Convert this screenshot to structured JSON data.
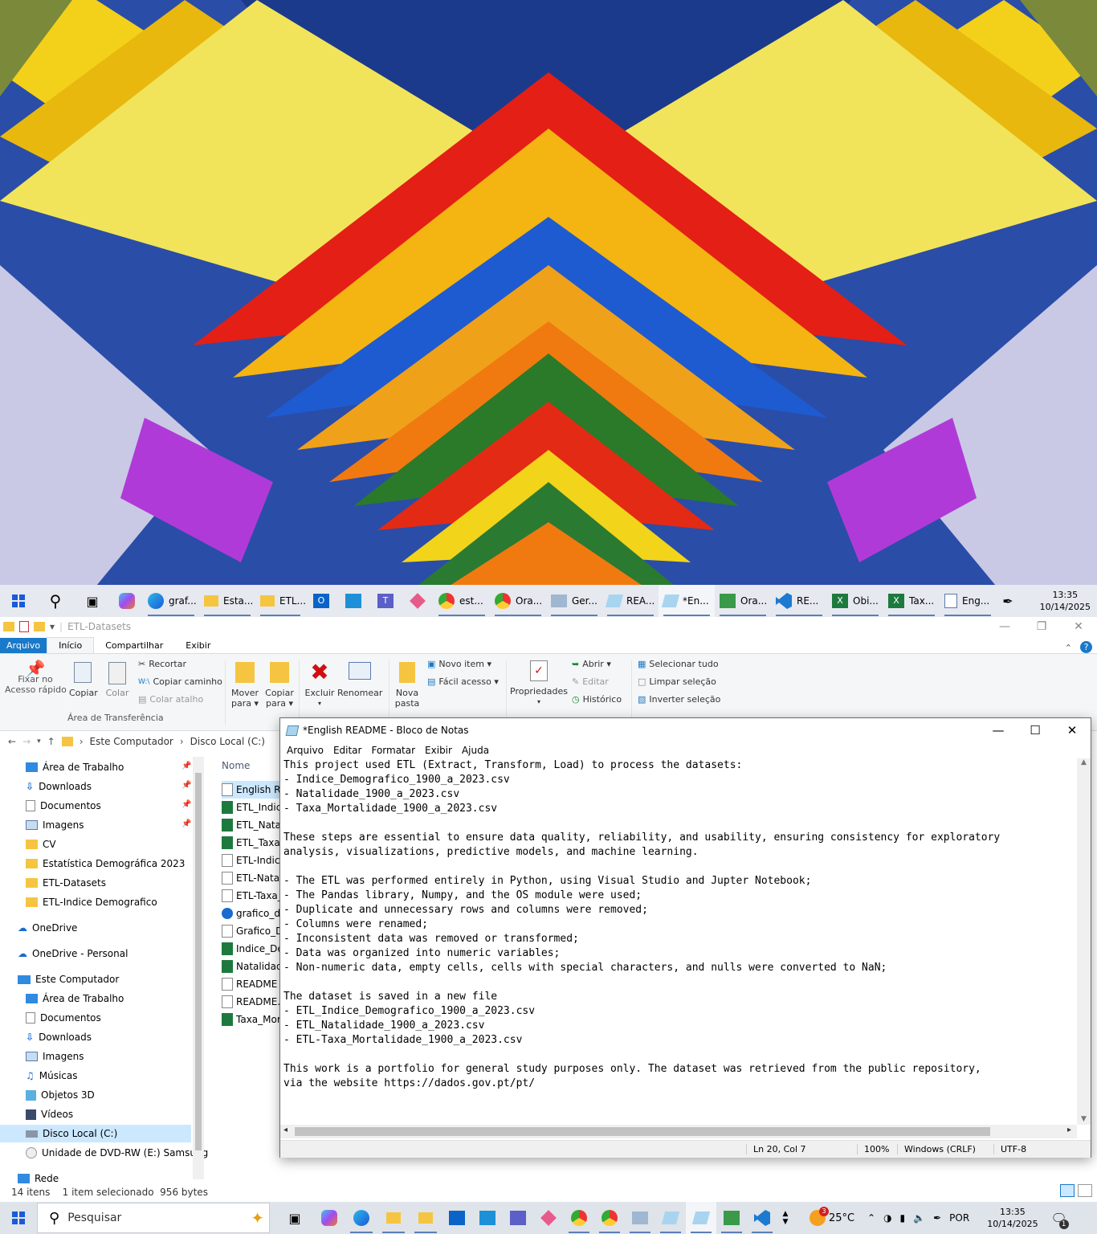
{
  "taskbar_top": {
    "items": [
      {
        "label": "graf..."
      },
      {
        "label": "Esta..."
      },
      {
        "label": "ETL..."
      },
      {
        "label": "est..."
      },
      {
        "label": "Ora..."
      },
      {
        "label": "Ger..."
      },
      {
        "label": "REA..."
      },
      {
        "label": "*En..."
      },
      {
        "label": "Ora..."
      },
      {
        "label": "RE..."
      },
      {
        "label": "Obi..."
      },
      {
        "label": "Tax..."
      },
      {
        "label": "Eng..."
      }
    ],
    "time": "13:35",
    "date": "10/14/2025"
  },
  "explorer": {
    "title": "ETL-Datasets",
    "tabs": {
      "file": "Arquivo",
      "home": "Início",
      "share": "Compartilhar",
      "view": "Exibir"
    },
    "ribbon": {
      "pin": "Fixar no\nAcesso rápido",
      "copy": "Copiar",
      "paste": "Colar",
      "cut": "Recortar",
      "copy_path": "Copiar caminho",
      "paste_shortcut": "Colar atalho",
      "clipboard_group": "Área de Transferência",
      "move_to": "Mover\npara ▾",
      "copy_to": "Copiar\npara ▾",
      "delete": "Excluir",
      "rename": "Renomear",
      "new_folder": "Nova\npasta",
      "new_item": "Novo item ▾",
      "easy_access": "Fácil acesso ▾",
      "properties": "Propriedades",
      "open": "Abrir ▾",
      "edit": "Editar",
      "history": "Histórico",
      "select_all": "Selecionar tudo",
      "select_none": "Limpar seleção",
      "invert": "Inverter seleção"
    },
    "address": {
      "root": "Este Computador",
      "drive": "Disco Local (C:)"
    },
    "nav": {
      "quick": [
        "Área de Trabalho",
        "Downloads",
        "Documentos",
        "Imagens",
        "CV",
        "Estatística Demográfica 2023",
        "ETL-Datasets",
        "ETL-Indice Demografico"
      ],
      "onedrive": "OneDrive",
      "onedrive_personal": "OneDrive - Personal",
      "this_pc": "Este Computador",
      "pc_items": [
        "Área de Trabalho",
        "Documentos",
        "Downloads",
        "Imagens",
        "Músicas",
        "Objetos 3D",
        "Vídeos",
        "Disco Local (C:)",
        "Unidade de DVD-RW (E:) Samsung"
      ],
      "network": "Rede"
    },
    "column_name": "Nome",
    "files": [
      "English REA",
      "ETL_Indice",
      "ETL_Natali",
      "ETL_Taxa_",
      "ETL-Indice",
      "ETL-Natali",
      "ETL-Taxa_",
      "grafico_di",
      "Grafico_D",
      "Indice_De",
      "Natalidad",
      "README",
      "README.",
      "Taxa_Mor"
    ],
    "status": "14 itens    1 item selecionado  956 bytes"
  },
  "notepad": {
    "title": "*English README - Bloco de Notas",
    "menu": [
      "Arquivo",
      "Editar",
      "Formatar",
      "Exibir",
      "Ajuda"
    ],
    "text": "This project used ETL (Extract, Transform, Load) to process the datasets:\n- Indice_Demografico_1900_a_2023.csv\n- Natalidade_1900_a_2023.csv\n- Taxa_Mortalidade_1900_a_2023.csv\n\nThese steps are essential to ensure data quality, reliability, and usability, ensuring consistency for exploratory\nanalysis, visualizations, predictive models, and machine learning.\n\n- The ETL was performed entirely in Python, using Visual Studio and Jupter Notebook;\n- The Pandas library, Numpy, and the OS module were used;\n- Duplicate and unnecessary rows and columns were removed;\n- Columns were renamed;\n- Inconsistent data was removed or transformed;\n- Data was organized into numeric variables;\n- Non-numeric data, empty cells, cells with special characters, and nulls were converted to NaN;\n\nThe dataset is saved in a new file\n- ETL_Indice_Demografico_1900_a_2023.csv\n- ETL_Natalidade_1900_a_2023.csv\n- ETL-Taxa_Mortalidade_1900_a_2023.csv\n\nThis work is a portfolio for general study purposes only. The dataset was retrieved from the public repository,\nvia the website https://dados.gov.pt/pt/",
    "status": {
      "position": "Ln 20, Col 7",
      "zoom": "100%",
      "eol": "Windows (CRLF)",
      "encoding": "UTF-8"
    }
  },
  "taskbar_bottom": {
    "search": "Pesquisar",
    "weather": "25°C",
    "weather_badge": "3",
    "language": "POR",
    "time": "13:35",
    "date": "10/14/2025",
    "notif": "1"
  }
}
